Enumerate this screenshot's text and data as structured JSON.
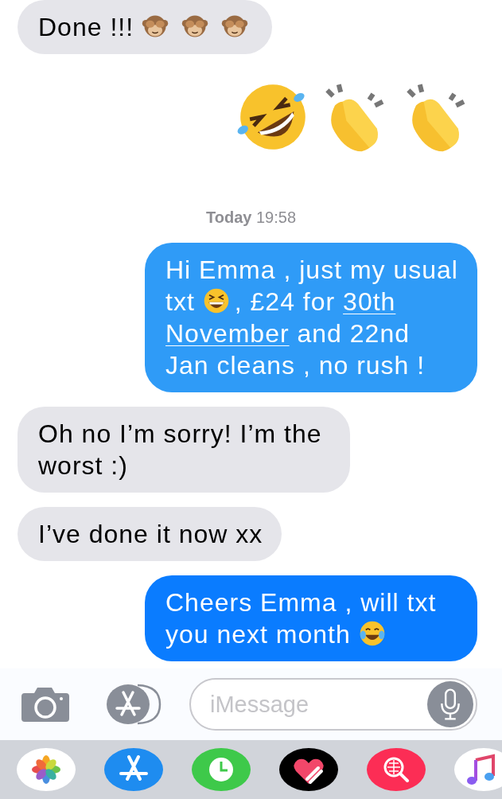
{
  "messages": [
    {
      "kind": "incoming",
      "color": "#e5e5ea",
      "parts": [
        {
          "kind": "text",
          "text": "Done !!!"
        },
        {
          "kind": "monkey"
        },
        {
          "kind": "monkey"
        },
        {
          "kind": "monkey"
        }
      ]
    },
    {
      "kind": "outgoing_emoji",
      "parts": [
        {
          "kind": "rofl"
        },
        {
          "kind": "clap"
        },
        {
          "kind": "clap"
        }
      ]
    },
    {
      "kind": "timestamp",
      "day": "Today",
      "time": "19:58"
    },
    {
      "kind": "outgoing",
      "color": "#2f9bf7",
      "parts": [
        {
          "kind": "text",
          "text": "Hi Emma , just my usual txt"
        },
        {
          "kind": "grin"
        },
        {
          "kind": "text",
          "text": ", £24 for "
        },
        {
          "kind": "link",
          "text": "30th"
        },
        {
          "kind": "link",
          "text": "November"
        },
        {
          "kind": "text",
          "text": " and 22nd Jan cleans , no rush !"
        }
      ]
    },
    {
      "kind": "incoming",
      "color": "#e5e5ea",
      "parts": [
        {
          "kind": "text",
          "text": "Oh no I’m sorry! I’m the worst :)"
        }
      ]
    },
    {
      "kind": "incoming",
      "color": "#e5e5ea",
      "parts": [
        {
          "kind": "text",
          "text": "I’ve done it now xx"
        }
      ]
    },
    {
      "kind": "outgoing",
      "color": "#0a7cff",
      "parts": [
        {
          "kind": "text",
          "text": "Cheers Emma , will txt you next month"
        },
        {
          "kind": "joy"
        }
      ]
    }
  ],
  "input": {
    "placeholder": "iMessage"
  },
  "dock": [
    {
      "kind": "photos"
    },
    {
      "kind": "appstore"
    },
    {
      "kind": "clock"
    },
    {
      "kind": "heart"
    },
    {
      "kind": "globe"
    },
    {
      "kind": "music"
    }
  ]
}
